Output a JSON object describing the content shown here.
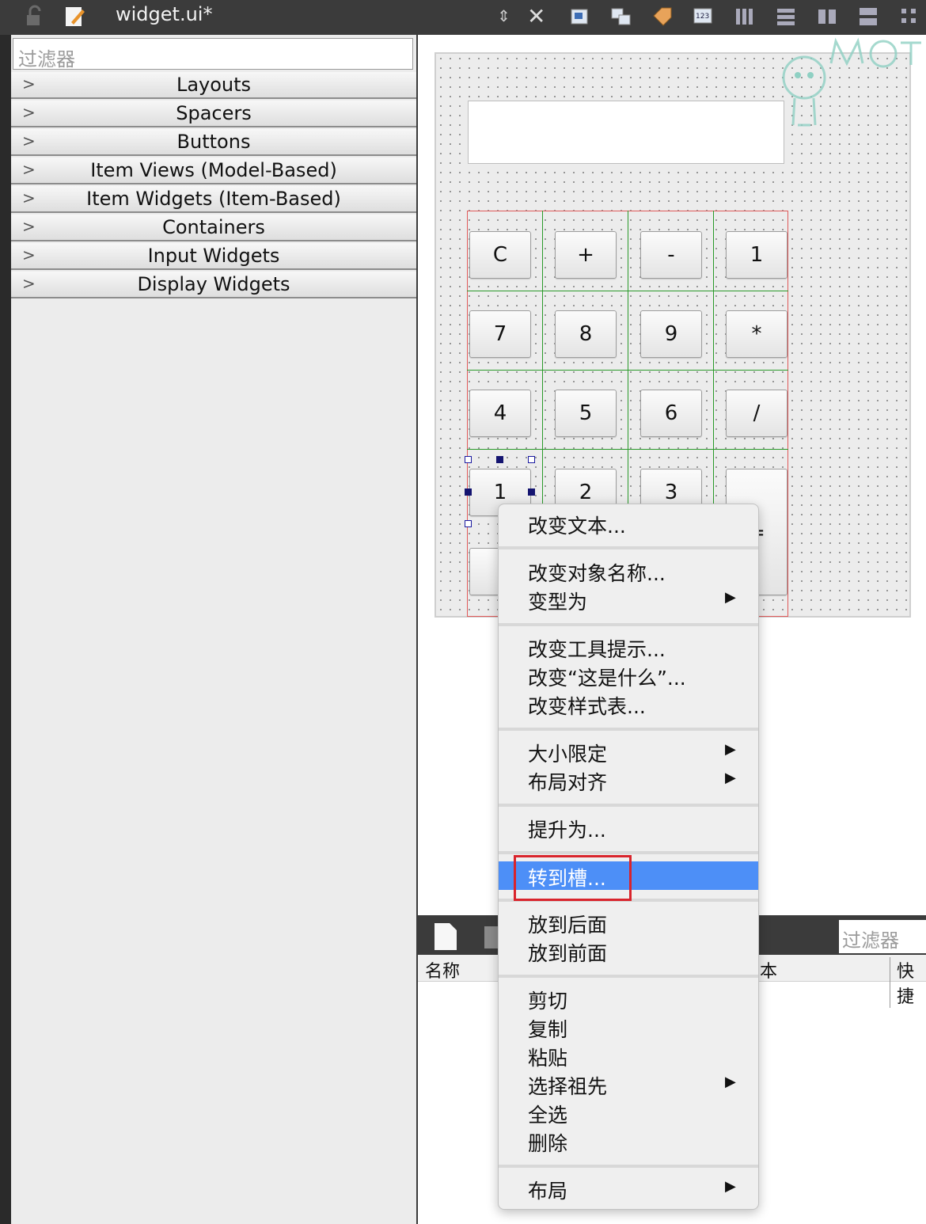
{
  "titlebar": {
    "title": "widget.ui*"
  },
  "widget_box": {
    "filter_placeholder": "过滤器",
    "categories": [
      "Layouts",
      "Spacers",
      "Buttons",
      "Item Views (Model-Based)",
      "Item Widgets (Item-Based)",
      "Containers",
      "Input Widgets",
      "Display Widgets"
    ]
  },
  "form": {
    "buttons": [
      "C",
      "+",
      "-",
      "1",
      "7",
      "8",
      "9",
      "*",
      "4",
      "5",
      "6",
      "/",
      "1",
      "2",
      "3",
      "="
    ]
  },
  "context_menu": {
    "items": [
      {
        "label": "改变文本..."
      },
      {
        "label": "改变对象名称..."
      },
      {
        "label": "变型为",
        "arrow": "▶"
      },
      {
        "label": "改变工具提示..."
      },
      {
        "label": "改变“这是什么”..."
      },
      {
        "label": "改变样式表..."
      },
      {
        "label": "大小限定",
        "arrow": "▶"
      },
      {
        "label": "布局对齐",
        "arrow": "▶"
      },
      {
        "label": "提升为..."
      },
      {
        "label": "转到槽...",
        "highlighted": true
      },
      {
        "label": "放到后面"
      },
      {
        "label": "放到前面"
      },
      {
        "label": "剪切"
      },
      {
        "label": "复制"
      },
      {
        "label": "粘贴"
      },
      {
        "label": "选择祖先",
        "arrow": "▶"
      },
      {
        "label": "全选"
      },
      {
        "label": "删除"
      },
      {
        "label": "布局",
        "arrow": "▶"
      }
    ]
  },
  "signal_slot_editor": {
    "filter_placeholder": "过滤器",
    "columns": [
      "名称",
      "本",
      "快捷"
    ]
  },
  "colors": {
    "highlight": "#4d8ff7",
    "annotation": "#d9242c",
    "layout_grid": "#2a9a2a"
  }
}
